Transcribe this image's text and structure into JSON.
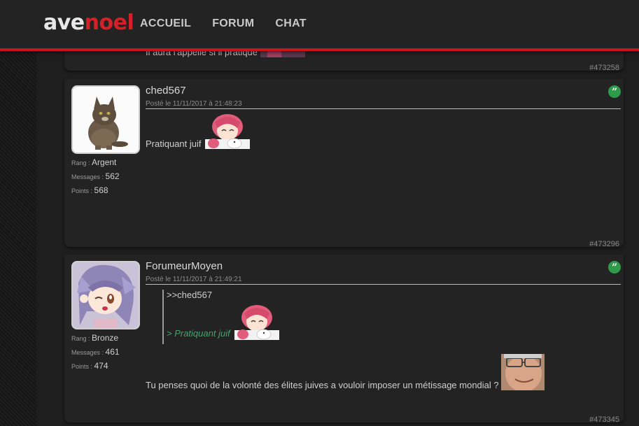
{
  "header": {
    "logo_part1": "ave",
    "logo_part2": "noel",
    "nav": [
      "ACCUEIL",
      "FORUM",
      "CHAT"
    ]
  },
  "posts": [
    {
      "partial_text": "Il aura l'appelle si il pratique",
      "id": "#473258"
    },
    {
      "username": "ched567",
      "date": "Posté le 11/11/2017 à 21:48:23",
      "rank_label": "Rang : ",
      "rank": "Argent",
      "messages_label": "Messages : ",
      "messages": "562",
      "points_label": "Points : ",
      "points": "568",
      "message": "Pratiquant juif",
      "quote_icon": "quote-icon",
      "id": "#473296"
    },
    {
      "username": "ForumeurMoyen",
      "date": "Posté le 11/11/2017 à 21:49:21",
      "rank_label": "Rang : ",
      "rank": "Bronze",
      "messages_label": "Messages : ",
      "messages": "461",
      "points_label": "Points : ",
      "points": "474",
      "quote_author": ">>ched567",
      "quote_text": "> Pratiquant juif",
      "message": "Tu penses quoi de la volonté des élites juives a vouloir imposer un métissage mondial ?",
      "quote_icon": "quote-icon",
      "id": "#473345"
    }
  ],
  "colors": {
    "accent_red": "#c4161c",
    "quote_green": "#2e9a4a",
    "background": "#1e1e1e"
  }
}
